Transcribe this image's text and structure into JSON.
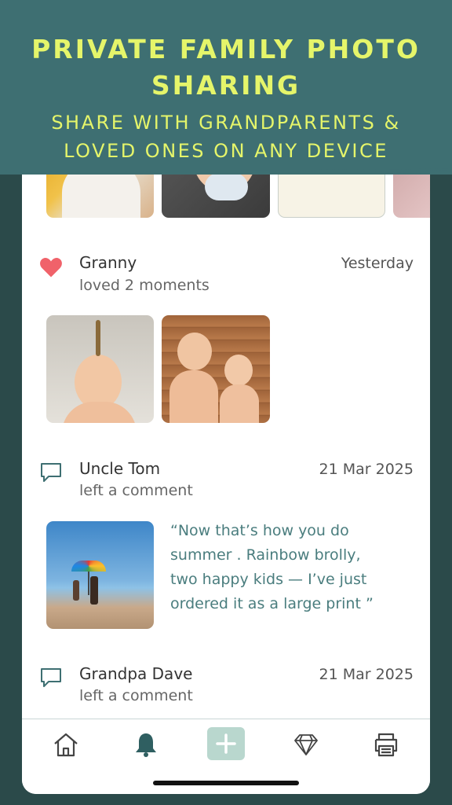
{
  "banner": {
    "headline_line1": "PRIVATE FAMILY PHOTO",
    "headline_line2": "SHARING",
    "sub_line1": "SHARE WITH GRANDPARENTS &",
    "sub_line2": "LOVED ONES ON ANY DEVICE"
  },
  "feed": [
    {
      "name": "Granny",
      "action": "loved 2 moments",
      "date": "Yesterday",
      "icon": "heart-icon"
    },
    {
      "name": "Uncle Tom",
      "action": "left a comment",
      "date": "21 Mar 2025",
      "icon": "comment-icon",
      "quote_l1": "“Now that’s how you do",
      "quote_l2": "summer     . Rainbow brolly,",
      "quote_l3": "two happy kids — I’ve just",
      "quote_l4": "ordered it as a large print     ”"
    },
    {
      "name": "Grandpa Dave",
      "action": "left a comment",
      "date": "21 Mar 2025",
      "icon": "comment-icon"
    }
  ],
  "tabs": [
    "home-icon",
    "bell-icon",
    "add-icon",
    "diamond-icon",
    "printer-icon"
  ],
  "colors": {
    "accent": "#e5f56a",
    "teal": "#3e6f72",
    "heart": "#f0626a"
  }
}
